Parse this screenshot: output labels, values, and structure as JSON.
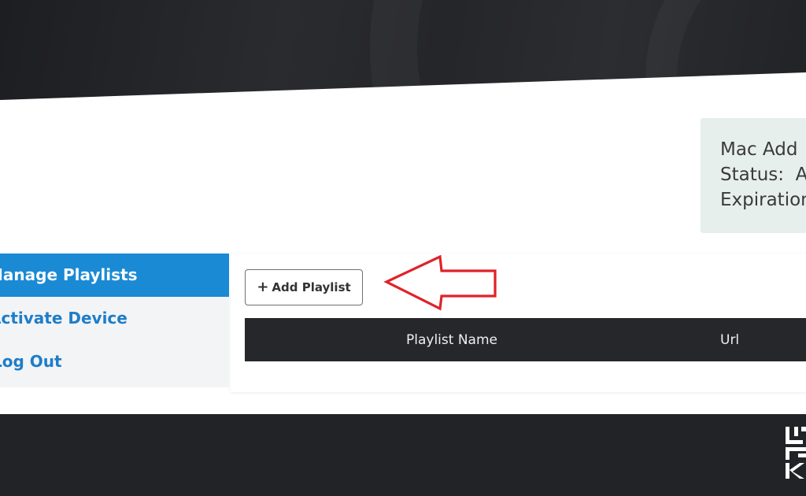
{
  "info": {
    "mac_label": "Mac Add",
    "status_label": "Status:",
    "status_value": "A",
    "expiration_label": "Expiration"
  },
  "menu": {
    "items": [
      {
        "label": "Manage Playlists",
        "active": true
      },
      {
        "label": "Activate Device",
        "active": false
      },
      {
        "label": "Log Out",
        "active": false
      }
    ]
  },
  "playlists": {
    "add_button_label": "Add Playlist",
    "add_button_icon": "plus-icon",
    "columns": [
      "Playlist Name",
      "Url"
    ],
    "rows": []
  },
  "annotation": {
    "arrow_color": "#e0222a",
    "arrow_icon": "left-arrow-icon"
  },
  "colors": {
    "accent": "#1a8ad5",
    "menu_text": "#1f7dc7",
    "table_header": "#25272b"
  }
}
